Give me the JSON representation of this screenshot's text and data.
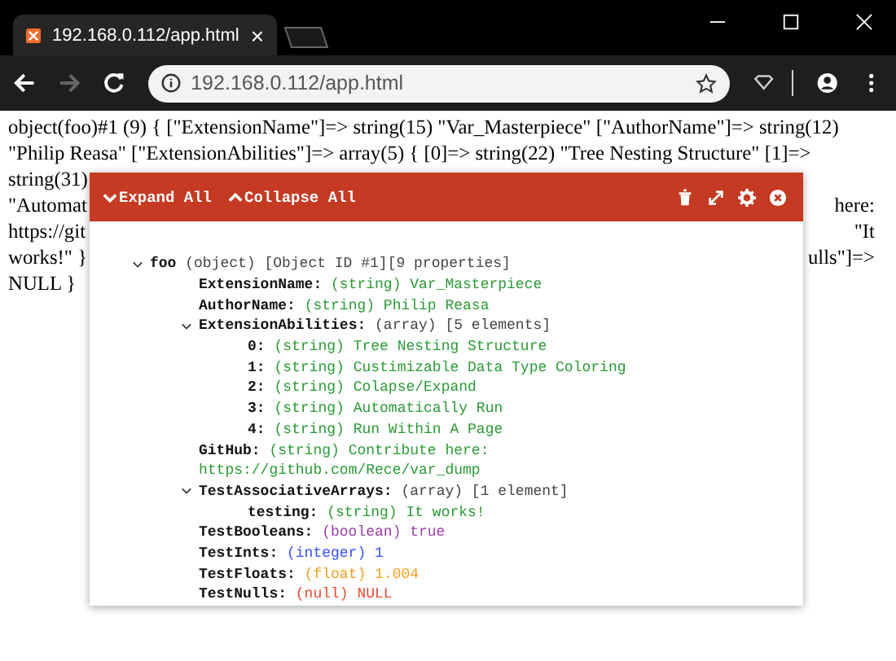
{
  "browser": {
    "tab": {
      "title": "192.168.0.112/app.html",
      "close": "×"
    },
    "forward": {
      "disabled": true
    },
    "address": "192.168.0.112/app.html"
  },
  "page_text": [
    {
      "left": "object(foo)#1 (9) { [\"ExtensionName\"]=> string(15) \"Var_Masterpiece\" [\"AuthorName\"]=> string(12)"
    },
    {
      "left": "\"Philip Reasa\" [\"ExtensionAbilities\"]=> array(5) { [0]=> string(22) \"Tree Nesting Structure\" [1]=>"
    },
    {
      "left": "string(31)"
    },
    {
      "left": "\"Automat",
      "right": "here:"
    },
    {
      "left": "https://git",
      "right": "\"It"
    },
    {
      "left": "works!\" }",
      "right": "ulls\"]=>"
    },
    {
      "left": "NULL }"
    }
  ],
  "dump_panel": {
    "buttons": [
      {
        "kind": "expand",
        "label": "Expand All"
      },
      {
        "kind": "collapse",
        "label": "Collapse All"
      }
    ],
    "tree": [
      {
        "key": "foo",
        "kind": "object",
        "type": "(object)",
        "meta": "[Object ID #1][9 properties]",
        "expanded": true,
        "children": [
          {
            "key": "ExtensionName:",
            "kind": "string",
            "type": "(string)",
            "value": "Var_Masterpiece"
          },
          {
            "key": "AuthorName:",
            "kind": "string",
            "type": "(string)",
            "value": "Philip Reasa"
          },
          {
            "key": "ExtensionAbilities:",
            "kind": "array",
            "type": "(array)",
            "meta": "[5 elements]",
            "expanded": true,
            "children": [
              {
                "key": "0:",
                "kind": "string",
                "type": "(string)",
                "value": "Tree Nesting Structure"
              },
              {
                "key": "1:",
                "kind": "string",
                "type": "(string)",
                "value": "Custimizable Data Type Coloring"
              },
              {
                "key": "2:",
                "kind": "string",
                "type": "(string)",
                "value": "Colapse/Expand"
              },
              {
                "key": "3:",
                "kind": "string",
                "type": "(string)",
                "value": "Automatically Run"
              },
              {
                "key": "4:",
                "kind": "string",
                "type": "(string)",
                "value": "Run Within A Page"
              }
            ]
          },
          {
            "key": "GitHub:",
            "kind": "string",
            "type": "(string)",
            "value": "Contribute here:",
            "continuation": "https://github.com/Rece/var_dump"
          },
          {
            "key": "TestAssociativeArrays:",
            "kind": "array",
            "type": "(array)",
            "meta": "[1 element]",
            "expanded": true,
            "children": [
              {
                "key": "testing:",
                "kind": "string",
                "type": "(string)",
                "value": "It works!"
              }
            ]
          },
          {
            "key": "TestBooleans:",
            "kind": "boolean",
            "type": "(boolean)",
            "value": "true"
          },
          {
            "key": "TestInts:",
            "kind": "integer",
            "type": "(integer)",
            "value": "1"
          },
          {
            "key": "TestFloats:",
            "kind": "float",
            "type": "(float)",
            "value": "1.004"
          },
          {
            "key": "TestNulls:",
            "kind": "null",
            "type": "(null)",
            "value": "NULL"
          }
        ]
      }
    ]
  }
}
